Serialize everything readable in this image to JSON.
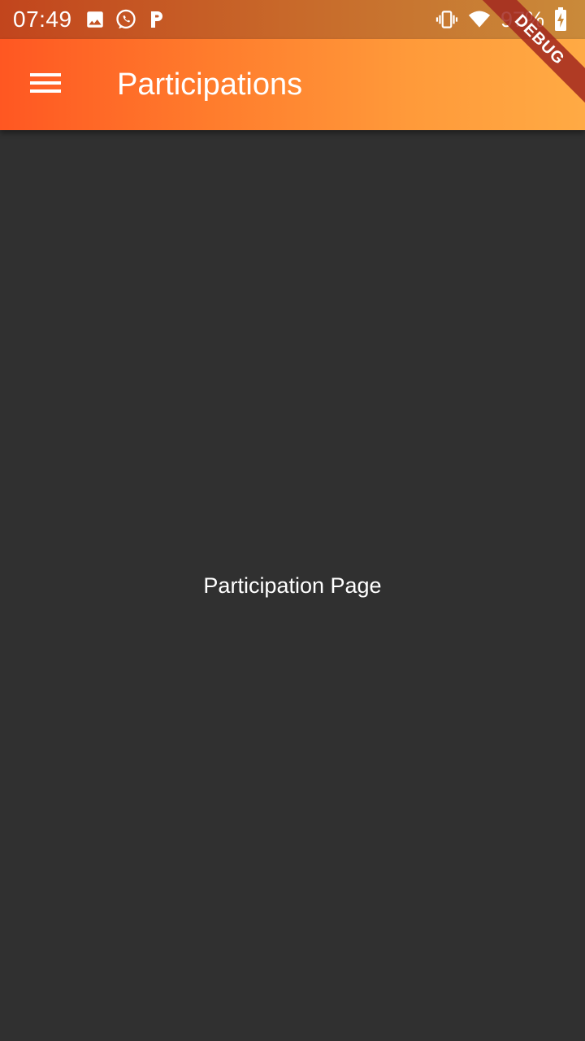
{
  "status_bar": {
    "time": "07:49",
    "left_icons": [
      "image-icon",
      "whatsapp-icon",
      "p-app-icon"
    ],
    "right_icons": [
      "vibrate-icon",
      "wifi-icon",
      "battery-charging-icon"
    ],
    "battery": "97%"
  },
  "app_bar": {
    "title": "Participations",
    "menu_icon": "hamburger-menu-icon",
    "gradient_start": "#ff5722",
    "gradient_end": "#ffaa44"
  },
  "debug_banner": {
    "label": "DEBUG"
  },
  "body": {
    "label": "Participation Page",
    "background": "#303030"
  }
}
